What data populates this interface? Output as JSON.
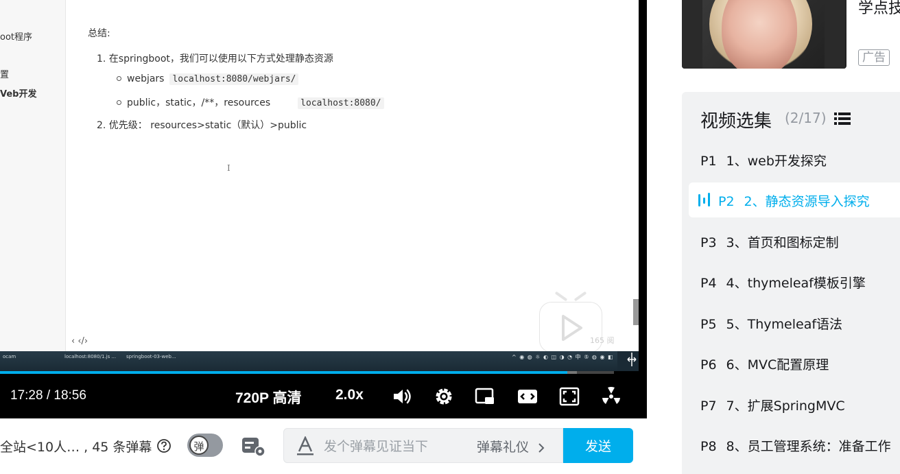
{
  "doc": {
    "sidebar": [
      "oot程序",
      "置",
      "Veb开发"
    ],
    "heading": "总结:",
    "item1": "1. 在springboot，我们可以使用以下方式处理静态资源",
    "sub1_text": "webjars",
    "sub1_code": "localhost:8080/webjars/",
    "sub2_text": "public，static，/**，resources",
    "sub2_code": "localhost:8080/",
    "item2": "2. 优先级： resources>static（默认）>public",
    "cursor": "I",
    "bottom_nav": "‹  ‹/›",
    "watermark": "165 阅"
  },
  "taskbar": {
    "items": [
      "ocam",
      "localhost:8080/1.js ...",
      "springboot-03-web..."
    ],
    "tray": "^ ◉ ◍ ☼ ◐ ◫ ◑ ◔ 中 ⑤ ◍ ◉ ◧"
  },
  "player": {
    "time": "17:28 / 18:56",
    "progress": 0.924,
    "buffered": 0.94,
    "quality": "720P 高清",
    "speed": "2.0x",
    "icons": [
      "volume-icon",
      "settings-icon",
      "miniplayer-icon",
      "widescreen-icon",
      "fullscreen-icon",
      "radiation-icon"
    ]
  },
  "danmaku": {
    "info": "全站<10人… , 45 条弹幕",
    "toggle_label": "弹",
    "placeholder": "发个弹幕见证当下",
    "etiquette": "弹幕礼仪",
    "send": "发送"
  },
  "ad": {
    "title": "学点技",
    "badge": "广告"
  },
  "playlist": {
    "title": "视频选集",
    "count": "(2/17)",
    "items": [
      {
        "p": "P1",
        "title": "1、web开发探究"
      },
      {
        "p": "P2",
        "title": "2、静态资源导入探究"
      },
      {
        "p": "P3",
        "title": "3、首页和图标定制"
      },
      {
        "p": "P4",
        "title": "4、thymeleaf模板引擎"
      },
      {
        "p": "P5",
        "title": "5、Thymeleaf语法"
      },
      {
        "p": "P6",
        "title": "6、MVC配置原理"
      },
      {
        "p": "P7",
        "title": "7、扩展SpringMVC"
      },
      {
        "p": "P8",
        "title": "8、员工管理系统：准备工作"
      }
    ],
    "active_index": 1
  },
  "colors": {
    "accent": "#00aeec",
    "panel_bg": "#f1f2f3",
    "text": "#18191c",
    "muted": "#9499a0"
  }
}
